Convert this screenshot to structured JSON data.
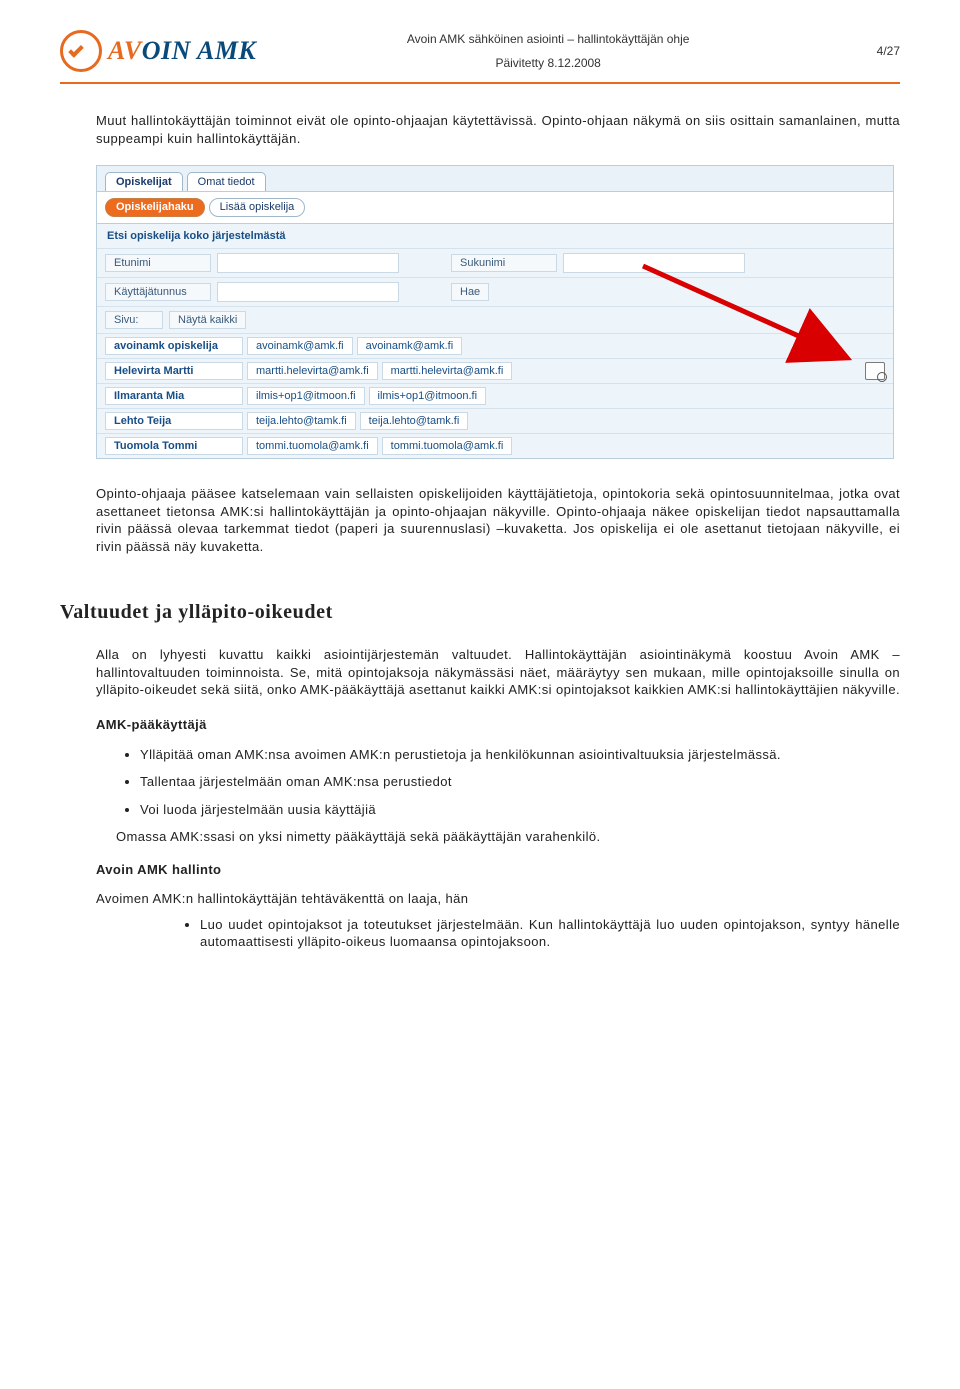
{
  "header": {
    "logo_a": "AV",
    "logo_b": "OIN AMK",
    "title": "Avoin AMK sähköinen asiointi – hallintokäyttäjän ohje",
    "date": "Päivitetty 8.12.2008",
    "page": "4/27"
  },
  "paragraph1": "Muut hallintokäyttäjän toiminnot eivät ole opinto-ohjaajan käytettävissä. Opinto-ohjaan näkymä on siis osittain samanlainen, mutta suppeampi kuin hallintokäyttäjän.",
  "app": {
    "tabs": {
      "t1": "Opiskelijat",
      "t2": "Omat tiedot"
    },
    "subtabs": {
      "s1": "Opiskelijahaku",
      "s2": "Lisää opiskelija"
    },
    "search_title": "Etsi opiskelija koko järjestelmästä",
    "labels": {
      "etunimi": "Etunimi",
      "sukunimi": "Sukunimi",
      "tunnus": "Käyttäjätunnus",
      "hae": "Hae",
      "sivu": "Sivu:",
      "nayta": "Näytä kaikki"
    },
    "rows": [
      {
        "name": "avoinamk opiskelija",
        "e1": "avoinamk@amk.fi",
        "e2": "avoinamk@amk.fi",
        "icon": false
      },
      {
        "name": "Helevirta Martti",
        "e1": "martti.helevirta@amk.fi",
        "e2": "martti.helevirta@amk.fi",
        "icon": true
      },
      {
        "name": "Ilmaranta Mia",
        "e1": "ilmis+op1@itmoon.fi",
        "e2": "ilmis+op1@itmoon.fi",
        "icon": false
      },
      {
        "name": "Lehto Teija",
        "e1": "teija.lehto@tamk.fi",
        "e2": "teija.lehto@tamk.fi",
        "icon": false
      },
      {
        "name": "Tuomola Tommi",
        "e1": "tommi.tuomola@amk.fi",
        "e2": "tommi.tuomola@amk.fi",
        "icon": false
      }
    ]
  },
  "paragraph2": "Opinto-ohjaaja pääsee katselemaan vain sellaisten opiskelijoiden käyttäjätietoja, opintokoria sekä opintosuunnitelmaa, jotka ovat asettaneet tietonsa AMK:si hallintokäyttäjän ja opinto-ohjaajan näkyville. Opinto-ohjaaja näkee opiskelijan tiedot napsauttamalla rivin päässä olevaa tarkemmat tiedot (paperi ja suurennuslasi) –kuvaketta. Jos opiskelija ei ole asettanut tietojaan näkyville, ei rivin päässä näy kuvaketta.",
  "section2_title": "Valtuudet ja ylläpito-oikeudet",
  "paragraph3": "Alla on lyhyesti kuvattu kaikki asiointijärjestemän valtuudet. Hallintokäyttäjän asiointinäkymä koostuu Avoin AMK –hallintovaltuuden toiminnoista. Se, mitä opintojaksoja näkymässäsi näet, määräytyy sen mukaan, mille opintojaksoille sinulla on ylläpito-oikeudet sekä siitä, onko AMK-pääkäyttäjä asettanut kaikki AMK:si opintojaksot kaikkien AMK:si hallintokäyttäjien näkyville.",
  "sub_amk": "AMK-pääkäyttäjä",
  "bul1": {
    "b1": "Ylläpitää oman AMK:nsa avoimen AMK:n perustietoja ja henkilökunnan asiointivaltuuksia järjestelmässä.",
    "b2": "Tallentaa järjestelmään oman AMK:nsa perustiedot",
    "b3": "Voi luoda järjestelmään uusia käyttäjiä"
  },
  "after_bul1": "Omassa AMK:ssasi on yksi nimetty pääkäyttäjä sekä pääkäyttäjän varahenkilö.",
  "sub_avoin": "Avoin AMK hallinto",
  "paragraph4": "Avoimen AMK:n hallintokäyttäjän tehtäväkenttä on laaja, hän",
  "bul2": {
    "b1": "Luo uudet opintojaksot ja toteutukset järjestelmään. Kun hallintokäyttäjä luo uuden opintojakson, syntyy hänelle automaattisesti ylläpito-oikeus luomaansa opintojaksoon."
  }
}
